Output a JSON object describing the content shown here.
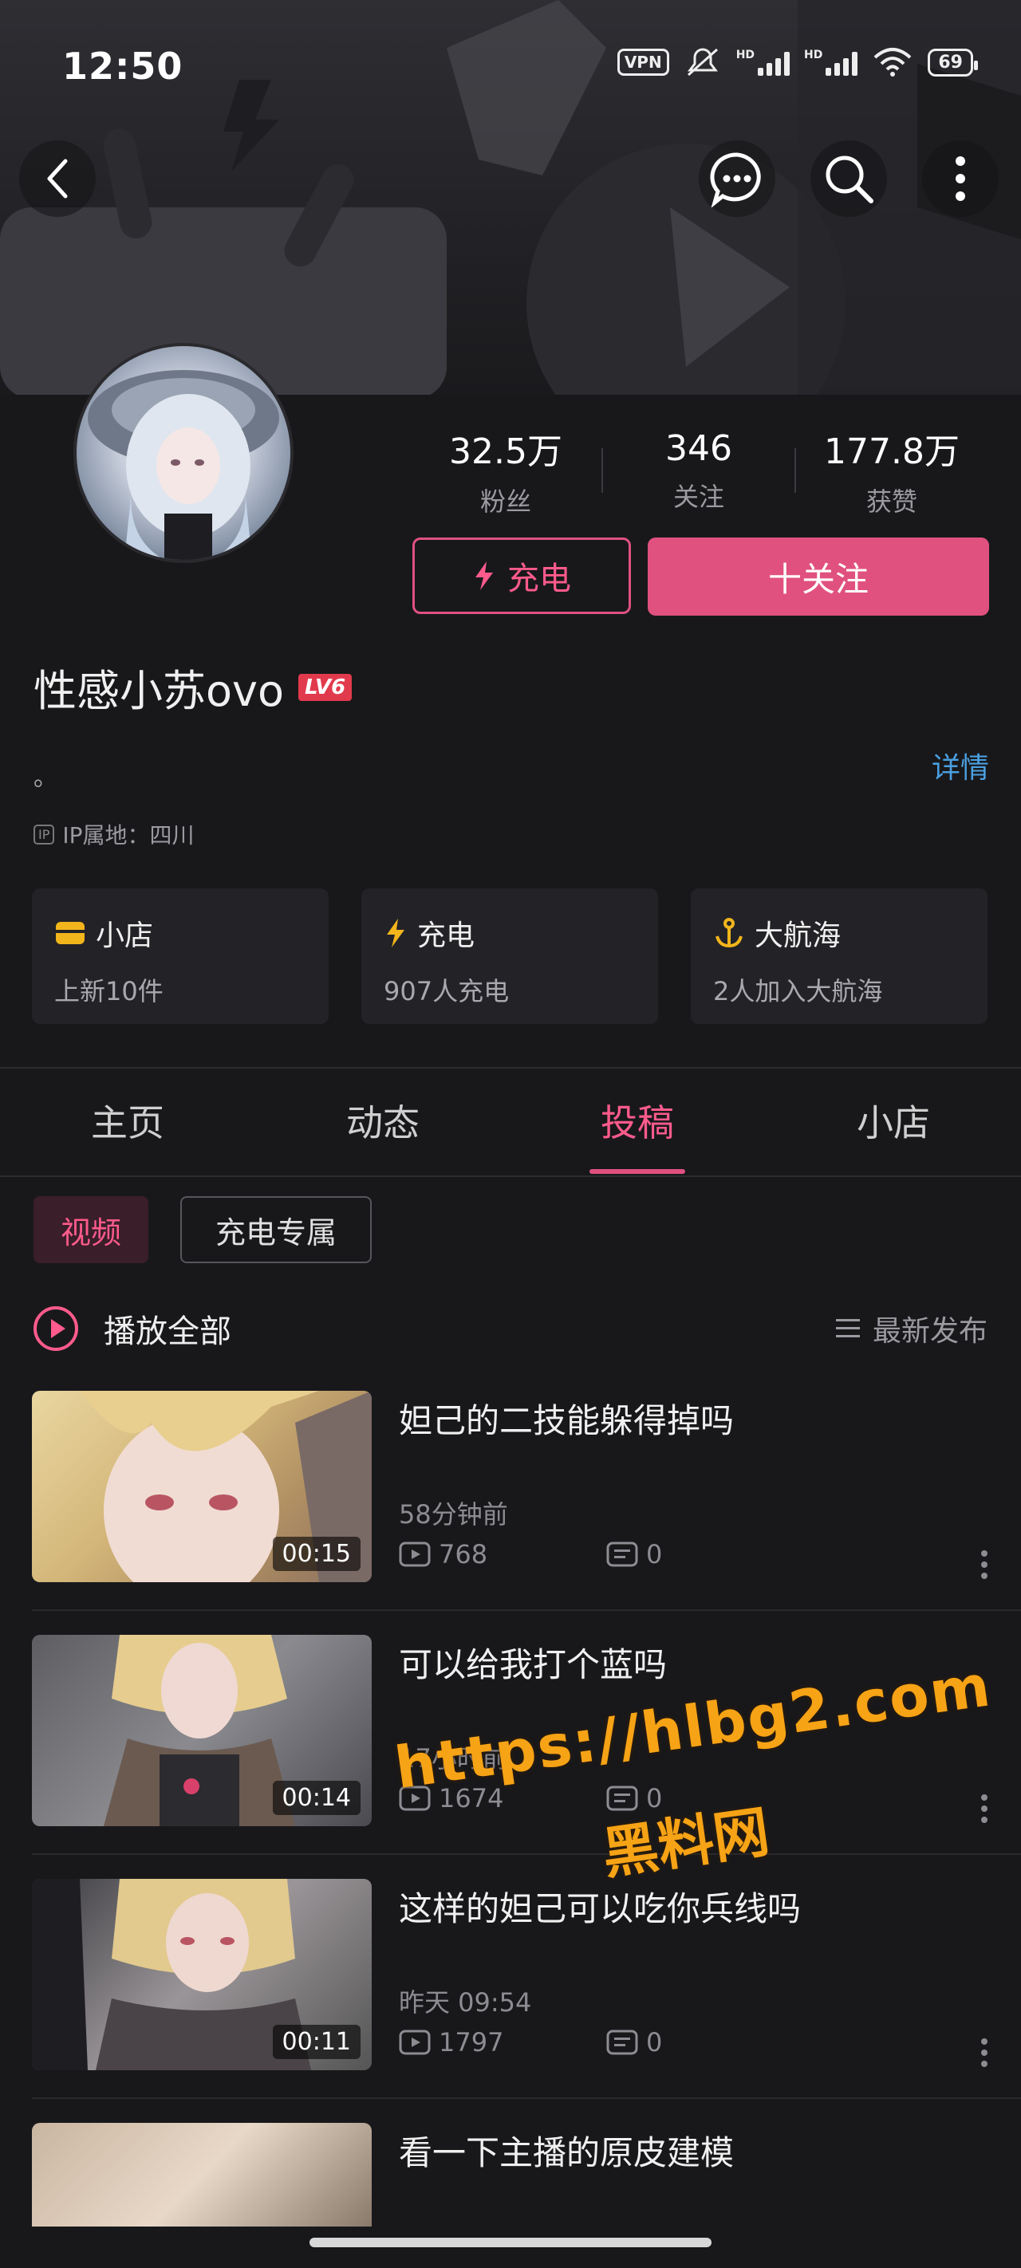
{
  "status_bar": {
    "time": "12:50",
    "vpn": "VPN",
    "hd1": "HD",
    "hd2": "HD",
    "battery": "69"
  },
  "header": {
    "back": "back",
    "icons": [
      "chat-icon",
      "search-icon",
      "more-icon"
    ]
  },
  "profile": {
    "stats": [
      {
        "value": "32.5万",
        "label": "粉丝"
      },
      {
        "value": "346",
        "label": "关注"
      },
      {
        "value": "177.8万",
        "label": "获赞"
      }
    ],
    "charge_button": "充电",
    "follow_button": "十关注",
    "username": "性感小苏ovo",
    "level": "LV6",
    "signature": "。",
    "detail_link": "详情",
    "ip_badge": "IP",
    "ip_location": "IP属地：四川"
  },
  "cards": [
    {
      "title": "小店",
      "subtitle": "上新10件",
      "icon": "shop-icon",
      "icon_color": "#f2b51c"
    },
    {
      "title": "充电",
      "subtitle": "907人充电",
      "icon": "lightning-icon",
      "icon_color": "#f2b51c"
    },
    {
      "title": "大航海",
      "subtitle": "2人加入大航海",
      "icon": "anchor-icon",
      "icon_color": "#f2b51c"
    }
  ],
  "tabs": [
    {
      "label": "主页",
      "active": false
    },
    {
      "label": "动态",
      "active": false
    },
    {
      "label": "投稿",
      "active": true
    },
    {
      "label": "小店",
      "active": false
    }
  ],
  "filters": {
    "video": "视频",
    "charge_only": "充电专属"
  },
  "list_header": {
    "play_all": "播放全部",
    "sort": "最新发布"
  },
  "videos": [
    {
      "title": "妲己的二技能躲得掉吗",
      "duration": "00:15",
      "time": "58分钟前",
      "plays": "768",
      "comments": "0"
    },
    {
      "title": "可以给我打个蓝吗",
      "duration": "00:14",
      "time": "17小时前",
      "plays": "1674",
      "comments": "0"
    },
    {
      "title": "这样的妲己可以吃你兵线吗",
      "duration": "00:11",
      "time": "昨天 09:54",
      "plays": "1797",
      "comments": "0"
    },
    {
      "title": "看一下主播的原皮建模",
      "duration": "",
      "time": "",
      "plays": "",
      "comments": ""
    }
  ],
  "watermark": {
    "url": "https://hlbg2.com",
    "name": "黑料网"
  },
  "colors": {
    "accent": "#e0517f",
    "background": "#18181b",
    "link": "#4a9fe0",
    "gold": "#f2b51c"
  }
}
